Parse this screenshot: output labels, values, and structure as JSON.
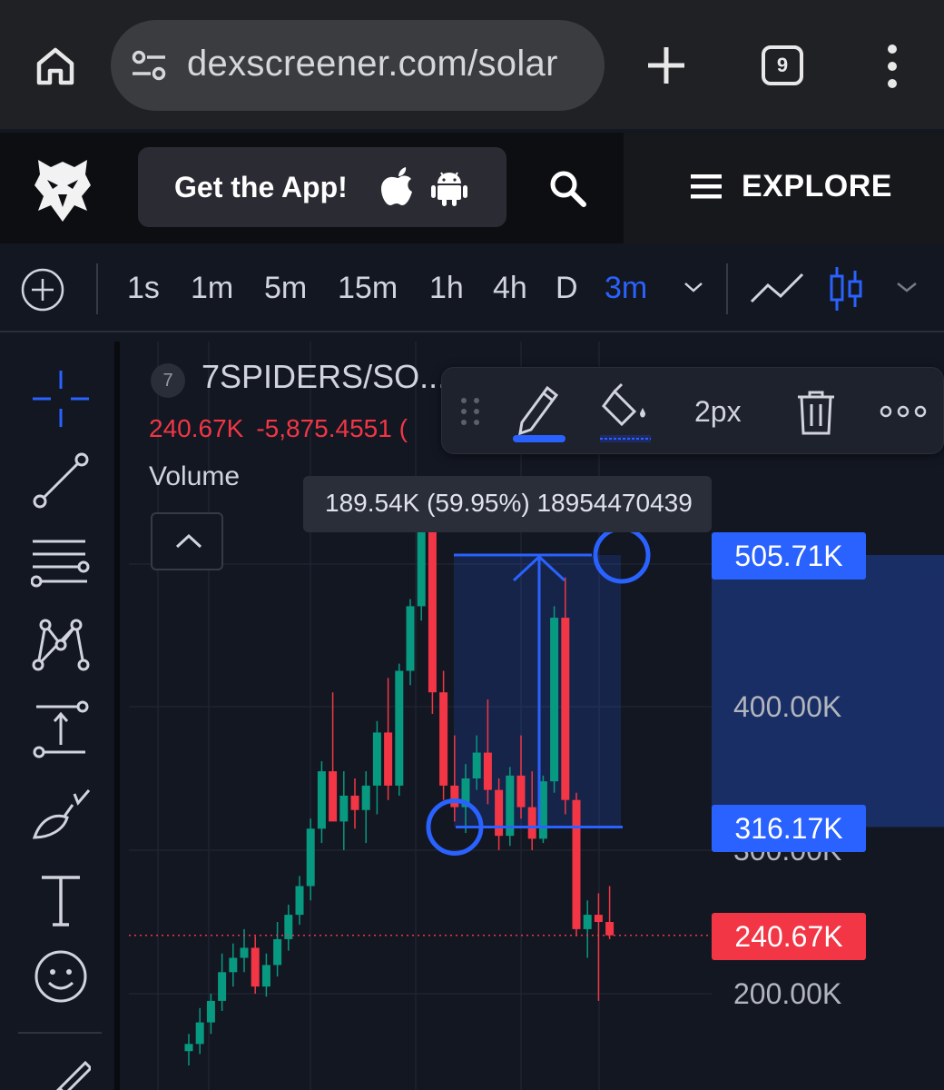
{
  "browser": {
    "url": "dexscreener.com/solar",
    "tab_count": "9"
  },
  "header": {
    "get_app_label": "Get the App!",
    "explore_label": "EXPLORE"
  },
  "timeframes": {
    "items": [
      "1s",
      "1m",
      "5m",
      "15m",
      "1h",
      "4h",
      "D",
      "3m"
    ],
    "active": "3m"
  },
  "left_tools": [
    "crosshair-icon",
    "trend-line-icon",
    "fib-retracement-icon",
    "pattern-icon",
    "measure-icon",
    "brush-icon",
    "text-tool-icon",
    "emoji-icon",
    "ruler-icon"
  ],
  "chart": {
    "legend_number": "7",
    "pair": "7SPIDERS/SO...",
    "ohlc_price": "240.67K",
    "ohlc_change": "-5,875.4551 (",
    "volume_label": "Volume",
    "drawing_toolbar": {
      "width_label": "2px"
    },
    "tooltip": "189.54K (59.95%) 18954470439",
    "price_axis": {
      "labels": [
        "400.00K",
        "300.00K",
        "200.00K"
      ],
      "target_box": "505.71K",
      "entry_box": "316.17K",
      "last_price_box": "240.67K"
    },
    "colors": {
      "up": "#089981",
      "down": "#f23645",
      "accent": "#2962ff",
      "background": "#131722"
    }
  },
  "chart_data": {
    "type": "candlestick",
    "price_range": [
      150000,
      600000
    ],
    "last_price": 240670,
    "measure": {
      "from": 316170,
      "to": 505710,
      "change": 189540,
      "change_pct": 59.95
    },
    "candles": [
      {
        "o": 160000,
        "h": 172000,
        "l": 150000,
        "c": 165000
      },
      {
        "o": 165000,
        "h": 190000,
        "l": 158000,
        "c": 180000
      },
      {
        "o": 180000,
        "h": 200000,
        "l": 172000,
        "c": 195000
      },
      {
        "o": 195000,
        "h": 228000,
        "l": 188000,
        "c": 215000
      },
      {
        "o": 215000,
        "h": 235000,
        "l": 205000,
        "c": 225000
      },
      {
        "o": 225000,
        "h": 245000,
        "l": 215000,
        "c": 232000
      },
      {
        "o": 232000,
        "h": 240000,
        "l": 200000,
        "c": 205000
      },
      {
        "o": 205000,
        "h": 228000,
        "l": 198000,
        "c": 220000
      },
      {
        "o": 220000,
        "h": 250000,
        "l": 212000,
        "c": 238000
      },
      {
        "o": 238000,
        "h": 262000,
        "l": 230000,
        "c": 255000
      },
      {
        "o": 255000,
        "h": 282000,
        "l": 248000,
        "c": 275000
      },
      {
        "o": 275000,
        "h": 322000,
        "l": 265000,
        "c": 315000
      },
      {
        "o": 315000,
        "h": 362000,
        "l": 305000,
        "c": 355000
      },
      {
        "o": 355000,
        "h": 410000,
        "l": 340000,
        "c": 320000
      },
      {
        "o": 320000,
        "h": 355000,
        "l": 300000,
        "c": 338000
      },
      {
        "o": 338000,
        "h": 350000,
        "l": 315000,
        "c": 328000
      },
      {
        "o": 328000,
        "h": 355000,
        "l": 305000,
        "c": 345000
      },
      {
        "o": 345000,
        "h": 390000,
        "l": 325000,
        "c": 382000
      },
      {
        "o": 382000,
        "h": 420000,
        "l": 335000,
        "c": 345000
      },
      {
        "o": 345000,
        "h": 430000,
        "l": 338000,
        "c": 425000
      },
      {
        "o": 425000,
        "h": 475000,
        "l": 415000,
        "c": 470000
      },
      {
        "o": 470000,
        "h": 535000,
        "l": 460000,
        "c": 525000
      },
      {
        "o": 525000,
        "h": 540000,
        "l": 395000,
        "c": 410000
      },
      {
        "o": 410000,
        "h": 425000,
        "l": 335000,
        "c": 345000
      },
      {
        "o": 345000,
        "h": 380000,
        "l": 320000,
        "c": 330000
      },
      {
        "o": 330000,
        "h": 360000,
        "l": 312000,
        "c": 350000
      },
      {
        "o": 350000,
        "h": 380000,
        "l": 342000,
        "c": 368000
      },
      {
        "o": 368000,
        "h": 405000,
        "l": 332000,
        "c": 342000
      },
      {
        "o": 342000,
        "h": 350000,
        "l": 300000,
        "c": 310000
      },
      {
        "o": 310000,
        "h": 358000,
        "l": 303000,
        "c": 352000
      },
      {
        "o": 352000,
        "h": 380000,
        "l": 322000,
        "c": 330000
      },
      {
        "o": 330000,
        "h": 355000,
        "l": 300000,
        "c": 308000
      },
      {
        "o": 308000,
        "h": 352000,
        "l": 305000,
        "c": 348000
      },
      {
        "o": 348000,
        "h": 470000,
        "l": 340000,
        "c": 462000
      },
      {
        "o": 462000,
        "h": 490000,
        "l": 325000,
        "c": 335000
      },
      {
        "o": 335000,
        "h": 340000,
        "l": 240000,
        "c": 245000
      },
      {
        "o": 245000,
        "h": 265000,
        "l": 225000,
        "c": 255000
      },
      {
        "o": 255000,
        "h": 270000,
        "l": 195000,
        "c": 250000
      },
      {
        "o": 250000,
        "h": 275000,
        "l": 238000,
        "c": 240670
      }
    ]
  }
}
